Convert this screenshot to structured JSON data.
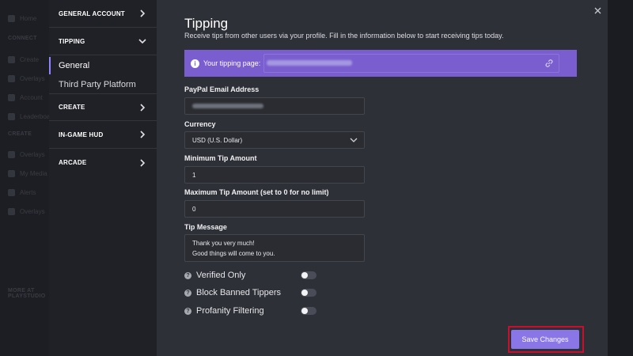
{
  "background_app": {
    "sidebar_items": [
      "Home",
      "CONNECT",
      "Create",
      "Overlays",
      "Account",
      "Leaderboard",
      "CREATE",
      "Overlays",
      "My Media",
      "Alerts",
      "Overlays",
      "MORE AT PLAYSTUDIO"
    ]
  },
  "settings_nav": {
    "groups": [
      {
        "label": "GENERAL ACCOUNT",
        "expanded": false
      },
      {
        "label": "TIPPING",
        "expanded": true
      },
      {
        "label": "CREATE",
        "expanded": false
      },
      {
        "label": "IN-GAME HUD",
        "expanded": false
      },
      {
        "label": "ARCADE",
        "expanded": false
      }
    ],
    "tipping_items": [
      {
        "label": "General",
        "active": true
      },
      {
        "label": "Third Party Platform",
        "active": false
      }
    ]
  },
  "page": {
    "title": "Tipping",
    "subtitle": "Receive tips from other users via your profile. Fill in the information below to start receiving tips today."
  },
  "banner": {
    "label": "Your tipping page:",
    "icon": "info-icon",
    "link_icon": "link-icon",
    "color": "#7a5ecf"
  },
  "form": {
    "paypal": {
      "label": "PayPal Email Address",
      "value_redacted": true
    },
    "currency": {
      "label": "Currency",
      "value": "USD (U.S. Dollar)"
    },
    "min_tip": {
      "label": "Minimum Tip Amount",
      "value": "1"
    },
    "max_tip": {
      "label": "Maximum Tip Amount (set to 0 for no limit)",
      "value": "0"
    },
    "message": {
      "label": "Tip Message",
      "line1": "Thank you very much!",
      "line2": "Good things will come to you."
    }
  },
  "toggles": [
    {
      "label": "Verified Only",
      "on": false
    },
    {
      "label": "Block Banned Tippers",
      "on": false
    },
    {
      "label": "Profanity Filtering",
      "on": false
    }
  ],
  "save_button": {
    "label": "Save Changes",
    "color": "#8b76e8",
    "highlight_color": "#c8102e"
  },
  "close_icon": "close-icon"
}
